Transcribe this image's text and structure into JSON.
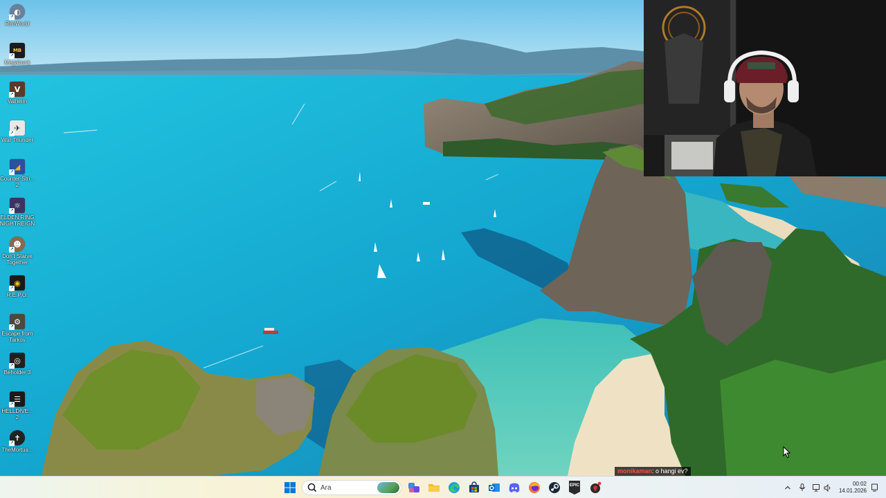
{
  "desktop": {
    "icons": [
      {
        "label": "RimWorld",
        "icon": "rimworld-icon",
        "color": "#6b7f9a"
      },
      {
        "label": "Megabonk",
        "icon": "megabonk-icon",
        "color": "#1c1c1c"
      },
      {
        "label": "Valheim",
        "icon": "valheim-icon",
        "color": "#5a3a2a"
      },
      {
        "label": "War Thunder",
        "icon": "war-thunder-icon",
        "color": "#e8e8e8"
      },
      {
        "label": "Counter-Stri... 2",
        "icon": "counter-strike-icon",
        "color": "#2c4fa0"
      },
      {
        "label": "ELDEN RING NIGHTREIGN",
        "icon": "elden-ring-icon",
        "color": "#3a3560"
      },
      {
        "label": "Don't Starve Together",
        "icon": "dont-starve-icon",
        "color": "#8a6a4a"
      },
      {
        "label": "R.E.P.O.",
        "icon": "repo-icon",
        "color": "#1a1a1a"
      },
      {
        "label": "Escape from Tarkov",
        "icon": "tarkov-icon",
        "color": "#4a4a40"
      },
      {
        "label": "Beholder 3",
        "icon": "beholder-icon",
        "color": "#202020"
      },
      {
        "label": "HELLDIVE... 2",
        "icon": "helldivers-icon",
        "color": "#1a1a1a"
      },
      {
        "label": "TheMortua...",
        "icon": "mortuary-icon",
        "color": "#222222"
      }
    ]
  },
  "chat_overlay": {
    "user": "monikaman",
    "message": ": o hangi ev?"
  },
  "taskbar": {
    "search_placeholder": "Ara",
    "apps": [
      {
        "name": "start-button",
        "icon": "windows-icon"
      },
      {
        "name": "copilot-button",
        "icon": "copilot-icon"
      },
      {
        "name": "file-explorer-button",
        "icon": "folder-icon"
      },
      {
        "name": "edge-button",
        "icon": "edge-icon"
      },
      {
        "name": "store-button",
        "icon": "store-icon"
      },
      {
        "name": "outlook-button",
        "icon": "outlook-icon"
      },
      {
        "name": "discord-button",
        "icon": "discord-icon"
      },
      {
        "name": "firefox-button",
        "icon": "firefox-icon"
      },
      {
        "name": "steam-button",
        "icon": "steam-icon"
      },
      {
        "name": "epic-games-button",
        "icon": "epic-games-icon",
        "label": "EPIC"
      },
      {
        "name": "app-button",
        "icon": "dark-app-icon"
      }
    ],
    "clock": {
      "time": "00:02",
      "date": "14.01.2026"
    }
  },
  "colors": {
    "sea": "#1fb5d5",
    "sky": "#9cd7f0",
    "chat_user": "#ff4a4a"
  }
}
